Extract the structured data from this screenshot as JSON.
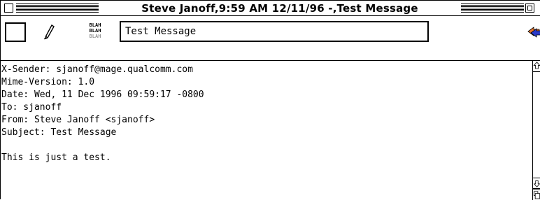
{
  "window": {
    "title": "Steve Janoff,9:59 AM 12/11/96 -,Test Message"
  },
  "toolbar": {
    "subject": "Test Message",
    "blah_icon_lines": [
      "BLAH",
      "BLAH",
      "BLAH"
    ]
  },
  "message": {
    "headers": [
      "X-Sender: sjanoff@mage.qualcomm.com",
      "Mime-Version: 1.0",
      "Date: Wed, 11 Dec 1996 09:59:17 -0800",
      "To: sjanoff",
      "From: Steve Janoff <sjanoff>",
      "Subject: Test Message"
    ],
    "body": [
      "This is just a test."
    ]
  },
  "icons": {
    "close": "close-box-icon",
    "zoom": "zoom-box-icon",
    "priority": "priority-box-icon",
    "pencil": "pencil-icon",
    "blah": "blah-blah-icon",
    "send": "send-arrow-icon",
    "scroll_up": "scroll-up-arrow-icon",
    "scroll_down": "scroll-down-arrow-icon",
    "grow": "grow-box-icon"
  },
  "colors": {
    "background": "#ffffff",
    "foreground": "#000000",
    "send_icon_orange": "#e8742a",
    "send_icon_blue": "#2a3ac8"
  }
}
